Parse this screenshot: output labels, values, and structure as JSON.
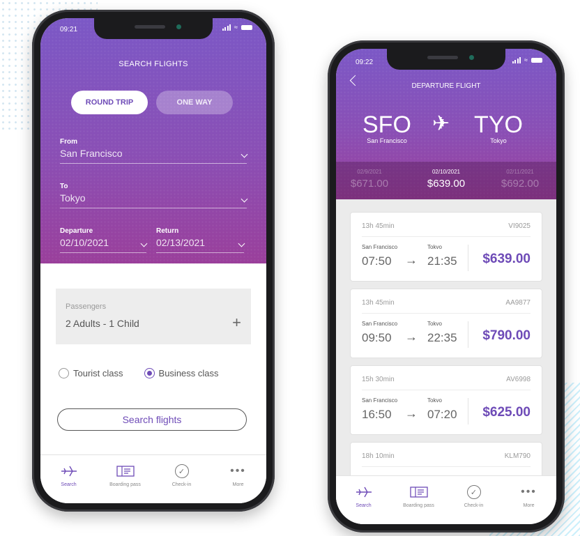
{
  "colors": {
    "accent": "#6e4bb7",
    "header_top": "#7b58c6",
    "header_bottom": "#9a3f9b"
  },
  "search_screen": {
    "status": {
      "time": "09:21"
    },
    "title": "SEARCH FLIGHTS",
    "trip_toggle": {
      "round_trip": "ROUND TRIP",
      "one_way": "ONE WAY",
      "selected": "round_trip"
    },
    "from": {
      "label": "From",
      "value": "San Francisco"
    },
    "to": {
      "label": "To",
      "value": "Tokyo"
    },
    "departure": {
      "label": "Departure",
      "value": "02/10/2021"
    },
    "return": {
      "label": "Return",
      "value": "02/13/2021"
    },
    "passengers": {
      "label": "Passengers",
      "value": "2 Adults  - 1 Child",
      "add_icon": "plus-icon"
    },
    "classes": [
      {
        "label": "Tourist class",
        "selected": false
      },
      {
        "label": "Business class",
        "selected": true
      }
    ],
    "search_button": "Search flights",
    "tabs": [
      {
        "label": "Search",
        "icon": "plane-icon",
        "active": true
      },
      {
        "label": "Boarding pass",
        "icon": "ticket-icon",
        "active": false
      },
      {
        "label": "Check-in",
        "icon": "check-icon",
        "active": false
      },
      {
        "label": "More",
        "icon": "more-icon",
        "active": false
      }
    ]
  },
  "departure_screen": {
    "status": {
      "time": "09:22"
    },
    "title": "DEPARTURE FLIGHT",
    "origin": {
      "code": "SFO",
      "city": "San Francisco"
    },
    "destination": {
      "code": "TYO",
      "city": "Tokyo"
    },
    "dates": [
      {
        "date": "02/9/2021",
        "price": "$671.00",
        "selected": false
      },
      {
        "date": "02/10/2021",
        "price": "$639.00",
        "selected": true
      },
      {
        "date": "02/11/2021",
        "price": "$692.00",
        "selected": false
      }
    ],
    "flights": [
      {
        "duration": "13h 45min",
        "code": "VI9025",
        "from_city": "San Francisco",
        "to_city": "Tokvo",
        "depart": "07:50",
        "arrive": "21:35",
        "price": "$639.00"
      },
      {
        "duration": "13h 45min",
        "code": "AA9877",
        "from_city": "San Francisco",
        "to_city": "Tokvo",
        "depart": "09:50",
        "arrive": "22:35",
        "price": "$790.00"
      },
      {
        "duration": "15h 30min",
        "code": "AV6998",
        "from_city": "San Francisco",
        "to_city": "Tokvo",
        "depart": "16:50",
        "arrive": "07:20",
        "price": "$625.00"
      },
      {
        "duration": "18h 10min",
        "code": "KLM790"
      }
    ],
    "tabs": [
      {
        "label": "Search",
        "icon": "plane-icon",
        "active": true
      },
      {
        "label": "Boarding pass",
        "icon": "ticket-icon",
        "active": false
      },
      {
        "label": "Check-in",
        "icon": "check-icon",
        "active": false
      },
      {
        "label": "More",
        "icon": "more-icon",
        "active": false
      }
    ]
  }
}
